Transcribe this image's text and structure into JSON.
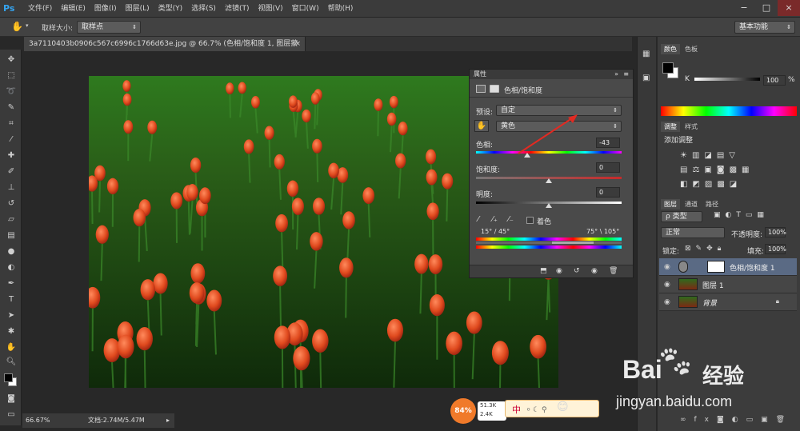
{
  "app": {
    "logo": "Ps"
  },
  "menu": [
    "文件(F)",
    "编辑(E)",
    "图像(I)",
    "图层(L)",
    "类型(Y)",
    "选择(S)",
    "滤镜(T)",
    "视图(V)",
    "窗口(W)",
    "帮助(H)"
  ],
  "window_controls": [
    "−",
    "□",
    "×"
  ],
  "options_bar": {
    "sample_size_label": "取样大小:",
    "sample_size_value": "取样点",
    "workspace": "基本功能"
  },
  "document_tab": {
    "title": "3a7110403b0906c567c6996c1766d63e.jpg @ 66.7% (色相/饱和度 1, 图层蒙版/8) *",
    "close": "×"
  },
  "properties": {
    "panel_title": "属性",
    "adjustment_name": "色相/饱和度",
    "preset_label": "预设:",
    "preset_value": "自定",
    "channel_value": "黄色",
    "hue_label": "色相:",
    "hue_value": "-43",
    "hue_fraction": 0.35,
    "saturation_label": "饱和度:",
    "saturation_value": "0",
    "lightness_label": "明度:",
    "lightness_value": "0",
    "colorize_label": "着色",
    "range_left": "15° / 45°",
    "range_right": "75° \\ 105°"
  },
  "color_panel": {
    "tab_color": "颜色",
    "tab_swatches": "色板",
    "k_label": "K",
    "k_value": "100",
    "k_unit": "%"
  },
  "adjust_panel": {
    "tab_adjust": "调整",
    "tab_styles": "样式",
    "add_adjustment": "添加调整"
  },
  "layers_panel": {
    "tab_layers": "图层",
    "tab_channels": "通道",
    "tab_paths": "路径",
    "filter_type": "ρ 类型",
    "blend_mode": "正常",
    "opacity_label": "不透明度:",
    "opacity_value": "100%",
    "lock_label": "锁定:",
    "fill_label": "填充:",
    "fill_value": "100%",
    "layers": [
      {
        "name": "色相/饱和度 1",
        "selected": true
      },
      {
        "name": "图层 1",
        "selected": false
      },
      {
        "name": "背景",
        "selected": false
      }
    ]
  },
  "status_bar": {
    "zoom": "66.67%",
    "doc_info": "文档:2.74M/5.47M"
  },
  "floating_widget": {
    "cpu": "84%",
    "up": "51.3K",
    "down": "2.4K",
    "ime": "中"
  },
  "watermark": {
    "brand": "Bai",
    "brand2": "经验",
    "url": "jingyan.baidu.com"
  },
  "colors": {
    "accent": "#35a4f0",
    "selected_layer": "#5a6a84",
    "tulip": "#e04a1e"
  }
}
